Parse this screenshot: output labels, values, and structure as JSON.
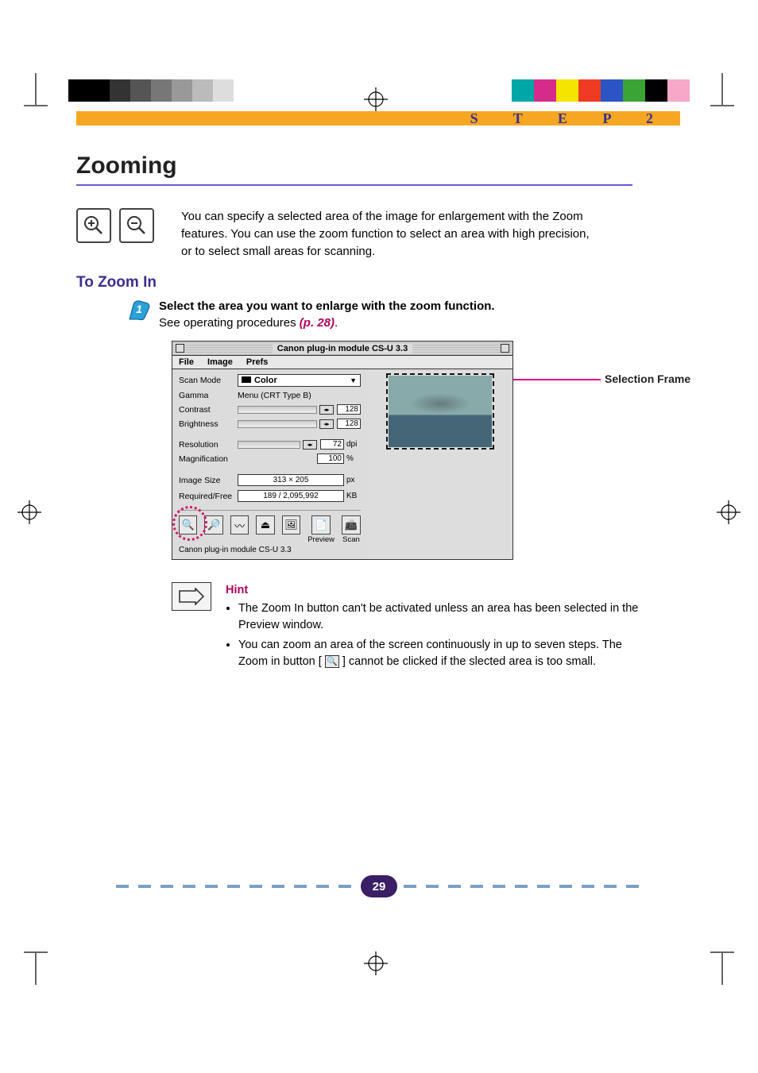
{
  "header": {
    "step_label": "S T E P   2"
  },
  "title": "Zooming",
  "intro": "You can specify a selected area of the image for enlargement with the Zoom features.  You can use the zoom function to select an area with high precision, or to select small areas for scanning.",
  "subhead": "To Zoom In",
  "step1": {
    "bold": "Select the area you want to enlarge with the zoom function.",
    "line2_a": "See operating procedures ",
    "page_ref": "(p. 28)",
    "line2_b": "."
  },
  "callout": "Selection Frame",
  "screenshot": {
    "title": "Canon plug-in module CS-U 3.3",
    "menu": {
      "file": "File",
      "image": "Image",
      "prefs": "Prefs"
    },
    "labels": {
      "scan_mode": "Scan Mode",
      "gamma": "Gamma",
      "contrast": "Contrast",
      "brightness": "Brightness",
      "resolution": "Resolution",
      "magnification": "Magnification",
      "image_size": "Image Size",
      "required_free": "Required/Free"
    },
    "values": {
      "scan_mode": "Color",
      "gamma": "Menu (CRT Type B)",
      "contrast": "128",
      "brightness": "128",
      "resolution": "72",
      "resolution_unit": "dpi",
      "magnification": "100",
      "magnification_unit": "%",
      "image_size": "313 × 205",
      "image_size_unit": "px",
      "required_free": "189 / 2,095,992",
      "required_free_unit": "KB"
    },
    "buttons": {
      "preview": "Preview",
      "scan": "Scan"
    },
    "status": "Canon plug-in module CS-U 3.3"
  },
  "hint": {
    "title": "Hint",
    "b1": "The Zoom In button can't be activated unless an area has been selected in the Preview window.",
    "b2_a": "You can zoom an area of the screen continuously in up to seven steps. The Zoom in button [ ",
    "b2_b": " ] cannot be clicked if the slected area is too small."
  },
  "page_number": "29",
  "gray_steps": [
    "#000000",
    "#000000",
    "#333333",
    "#555555",
    "#777777",
    "#999999",
    "#bbbbbb",
    "#dddddd"
  ],
  "cmyk": [
    "#00a7a7",
    "#d62b8a",
    "#f4e400",
    "#ef3b24",
    "#2b55c4",
    "#3aa535",
    "#000000",
    "#f7a8c9"
  ]
}
